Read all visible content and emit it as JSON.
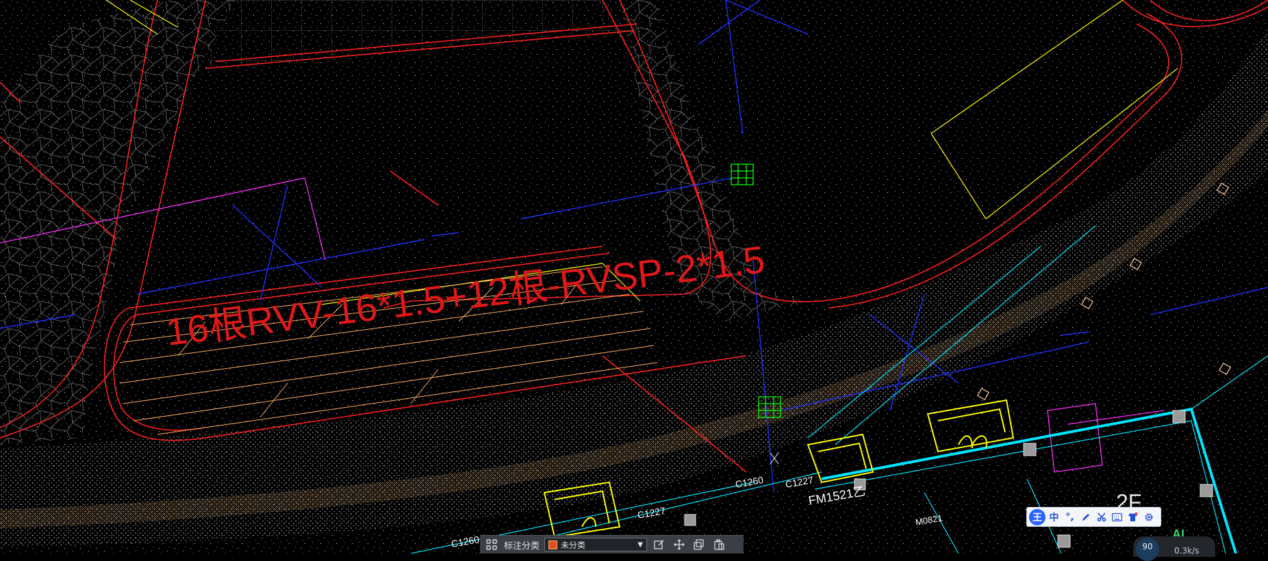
{
  "drawing": {
    "cable_annotation": "16根RVV-16*1.5+12根-RVSP-2*1.5",
    "floor_label": "2F",
    "tags": {
      "window_c1260_a": "C1260",
      "window_c1227_a": "C1227",
      "window_c1260_b": "C1260",
      "window_c1227_b": "C1227",
      "door_fm1521": "FM1521乙",
      "door_m0821": "M0821"
    },
    "colors": {
      "wall": "#ff2020",
      "pipe": "#2030ff",
      "magenta": "#ff30ff",
      "cyan": "#00e5ff",
      "yellow": "#ffff00",
      "green": "#00ff00",
      "orange": "#ffb060",
      "hatch": "#ffffff"
    }
  },
  "annotation_toolbar": {
    "grid_icon": "grid-icon",
    "label": "标注分类",
    "select_value": "未分类",
    "tools": [
      "edit-icon",
      "move-icon",
      "copy-icon",
      "paste-icon"
    ]
  },
  "ime_toolbar": {
    "logo": "王",
    "mode": "中",
    "punct": "°,",
    "icons": [
      "pen-icon",
      "scissors-icon",
      "keyboard-icon",
      "shirt-icon",
      "gear-icon"
    ]
  },
  "status": {
    "ai_label": "AI",
    "gauge_value": "90",
    "net_speed": "0.3k/s"
  }
}
